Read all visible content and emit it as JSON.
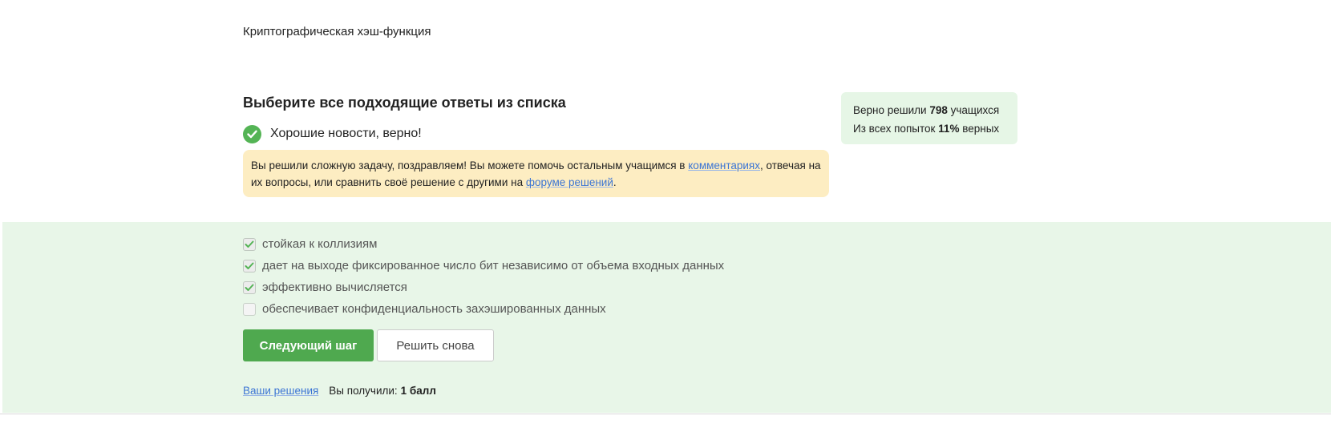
{
  "question": {
    "text": "Криптографическая хэш-функция"
  },
  "task": {
    "title": "Выберите все подходящие ответы из списка"
  },
  "stats": {
    "solved_prefix": "Верно решили",
    "solved_count": "798",
    "solved_suffix": "учащихся",
    "attempts_prefix": "Из всех попыток",
    "attempts_percent": "11%",
    "attempts_suffix": "верных"
  },
  "feedback": {
    "text": "Хорошие новости, верно!",
    "status_color": "#54b455"
  },
  "notice": {
    "part1": "Вы решили сложную задачу, поздравляем! Вы можете помочь остальным учащимся в",
    "link1": "комментариях",
    "part2": ", отвечая на их вопросы, или сравнить своё решение с другими на",
    "link2": "форуме решений",
    "part3": "."
  },
  "answers": [
    {
      "label": "стойкая к коллизиям",
      "checked": true
    },
    {
      "label": "дает на выходе фиксированное число бит независимо от объема входных данных",
      "checked": true
    },
    {
      "label": "эффективно вычисляется",
      "checked": true
    },
    {
      "label": "обеспечивает конфиденциальность захэшированных данных",
      "checked": false
    }
  ],
  "actions": {
    "next_label": "Следующий шаг",
    "retry_label": "Решить снова"
  },
  "footer": {
    "solutions_link": "Ваши решения",
    "score_prefix": "Вы получили:",
    "score_value": "1 балл"
  },
  "colors": {
    "accent_green": "#4fa94f",
    "answers_bg": "#e8f6e8",
    "notice_bg": "#fdedc2",
    "link": "#3c75d4"
  }
}
